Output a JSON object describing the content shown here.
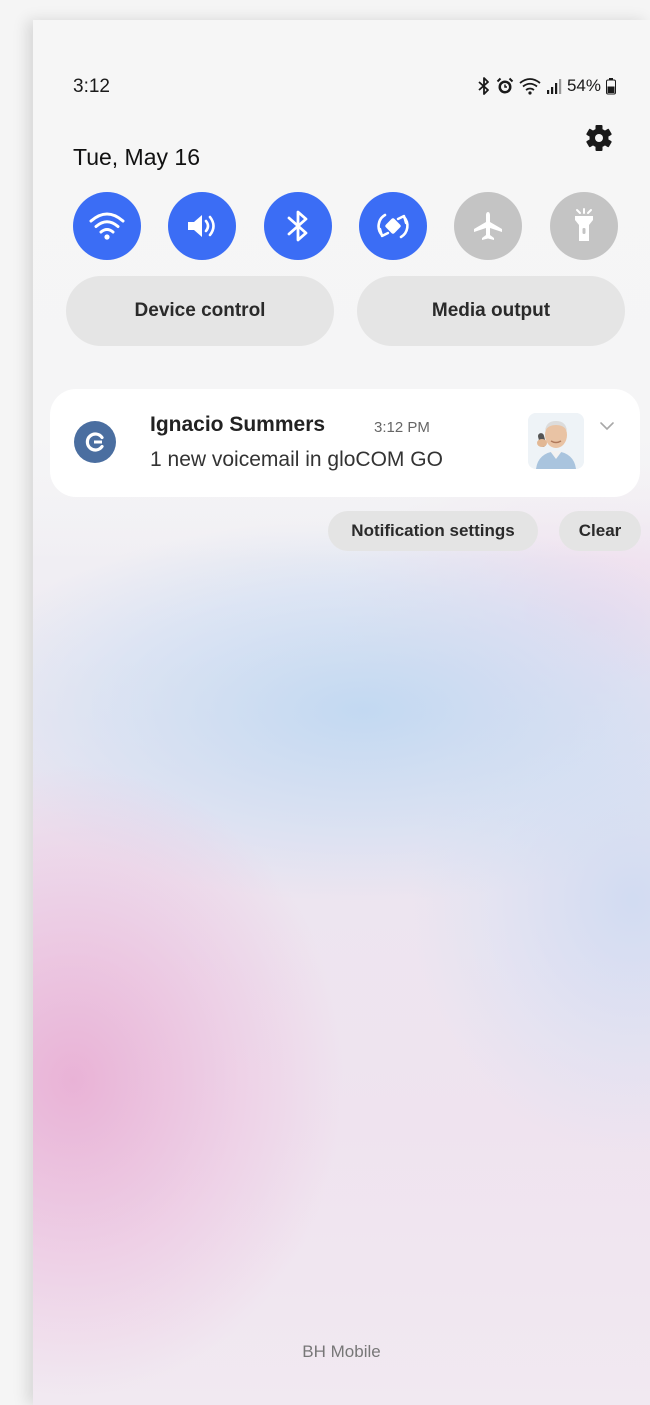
{
  "status_bar": {
    "time": "3:12",
    "battery": "54%",
    "icons": [
      "bluetooth-icon",
      "alarm-icon",
      "wifi-icon",
      "signal-icon",
      "battery-icon"
    ]
  },
  "date": "Tue, May 16",
  "quick_settings": {
    "accent": "#3b6df5",
    "inactive": "#c4c4c4",
    "tiles": [
      {
        "icon": "wifi-icon",
        "on": true
      },
      {
        "icon": "sound-icon",
        "on": true
      },
      {
        "icon": "bluetooth-icon",
        "on": true
      },
      {
        "icon": "auto-rotate-icon",
        "on": true
      },
      {
        "icon": "airplane-icon",
        "on": false
      },
      {
        "icon": "flashlight-icon",
        "on": false
      }
    ],
    "device_control": "Device control",
    "media_output": "Media output"
  },
  "notification": {
    "app_icon": "glocom-app-icon",
    "sender": "Ignacio Summers",
    "time": "3:12 PM",
    "message": "1 new voicemail in gloCOM GO"
  },
  "actions": {
    "notification_settings": "Notification settings",
    "clear": "Clear"
  },
  "carrier": "BH Mobile"
}
